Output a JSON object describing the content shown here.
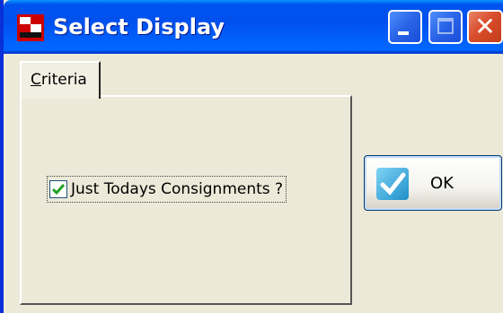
{
  "window": {
    "title": "Select Display"
  },
  "tabs": [
    {
      "label": "Criteria",
      "mnemonic": "C",
      "rest": "riteria"
    }
  ],
  "criteria": {
    "just_todays_label": "Just Todays Consignments ?",
    "just_todays_checked": true
  },
  "actions": {
    "ok_label": "OK"
  },
  "colors": {
    "titlebar": "#0053ee",
    "close_button": "#d94e2c",
    "face": "#ece9d8",
    "check": "#21a121",
    "ok_icon": "#2ea0d8"
  },
  "icons": [
    "app-icon",
    "minimize-icon",
    "maximize-icon",
    "close-icon",
    "checkmark-icon",
    "ok-checkmark-icon"
  ]
}
